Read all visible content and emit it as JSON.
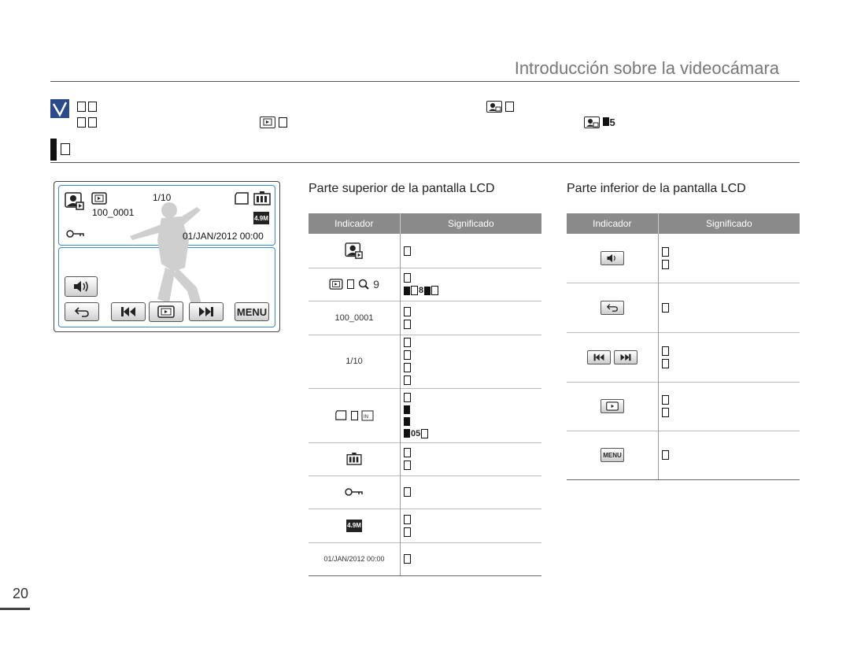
{
  "header": {
    "title": "Introducción sobre la videocámara"
  },
  "page_number": "20",
  "note": {
    "line2_suffix": "5"
  },
  "lcd": {
    "counter": "1/10",
    "file_number": "100_0001",
    "datetime": "01/JAN/2012 00:00",
    "photo_size": "4.9M",
    "menu_label": "MENU"
  },
  "upper_table": {
    "title": "Parte superior de la pantalla LCD",
    "col_indicator": "Indicador",
    "col_meaning": "Significado",
    "rows": [
      {
        "indicator": ""
      },
      {
        "indicator": "9",
        "extra": "8"
      },
      {
        "indicator": "100_0001"
      },
      {
        "indicator": "1/10"
      },
      {
        "indicator": "",
        "extra": "05"
      },
      {
        "indicator": ""
      },
      {
        "indicator": ""
      },
      {
        "indicator": "4.9M"
      },
      {
        "indicator": "01/JAN/2012 00:00"
      }
    ]
  },
  "lower_table": {
    "title": "Parte inferior de la pantalla LCD",
    "col_indicator": "Indicador",
    "col_meaning": "Significado",
    "menu_label": "MENU"
  }
}
